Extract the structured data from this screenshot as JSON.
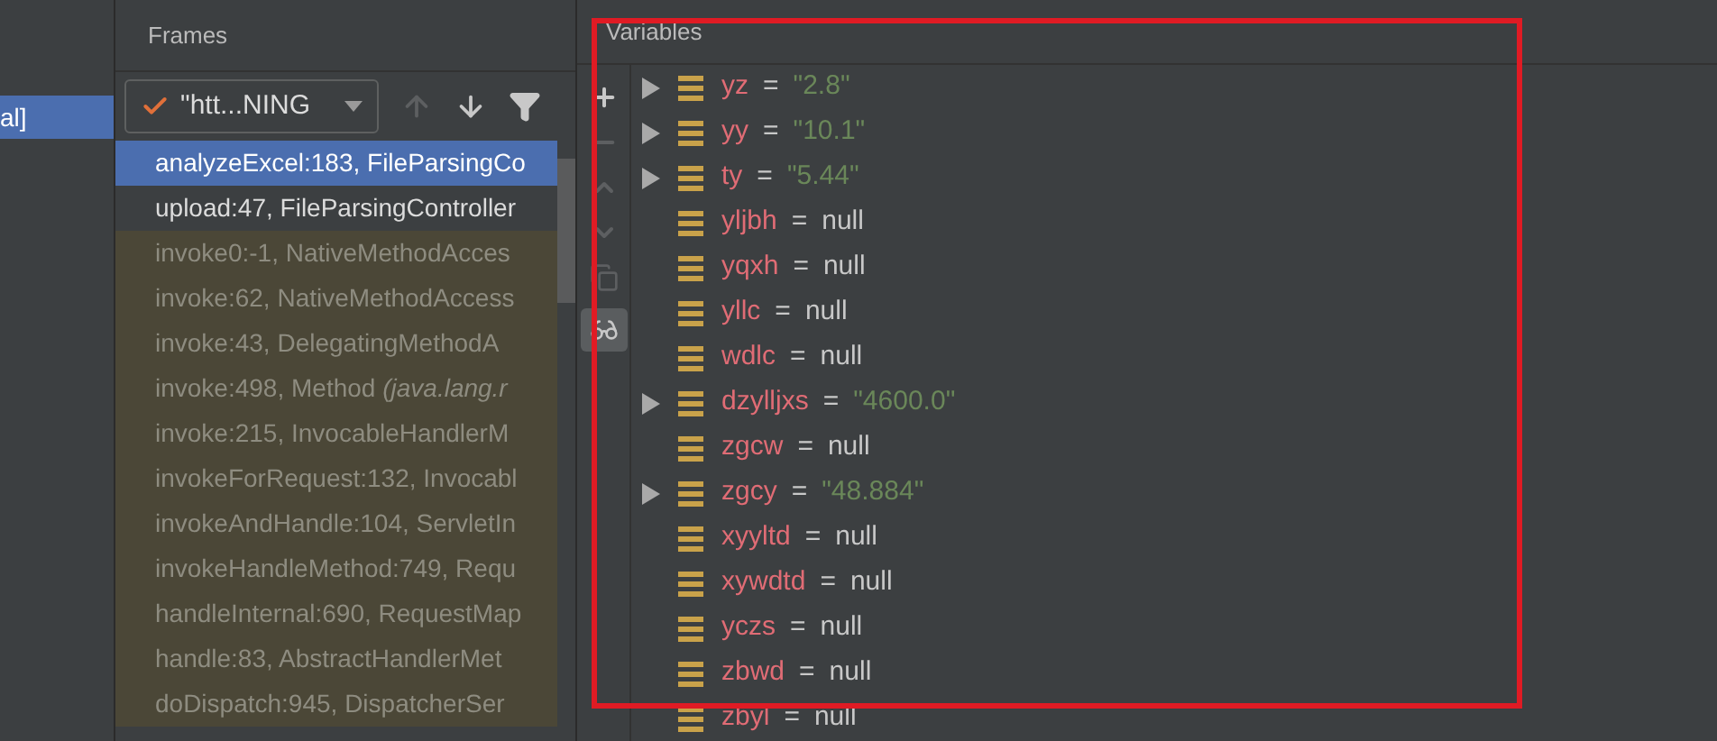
{
  "left_strip": {
    "item": {
      "label": "al]",
      "selected": true
    }
  },
  "frames": {
    "title": "Frames",
    "thread_dropdown": {
      "label": "\"htt...NING"
    },
    "items": [
      {
        "label": "analyzeExcel:183, FileParsingCo",
        "kind": "app",
        "selected": true
      },
      {
        "label": "upload:47, FileParsingController",
        "kind": "app",
        "selected": false
      },
      {
        "label": "invoke0:-1, NativeMethodAcces",
        "kind": "library",
        "selected": false
      },
      {
        "label": "invoke:62, NativeMethodAccess",
        "kind": "library",
        "selected": false
      },
      {
        "label": "invoke:43, DelegatingMethodA",
        "kind": "library",
        "selected": false
      },
      {
        "label": "invoke:498, Method *(java.lang.r*",
        "kind": "library",
        "selected": false
      },
      {
        "label": "invoke:215, InvocableHandlerM",
        "kind": "library",
        "selected": false
      },
      {
        "label": "invokeForRequest:132, Invocabl",
        "kind": "library",
        "selected": false
      },
      {
        "label": "invokeAndHandle:104, ServletIn",
        "kind": "library",
        "selected": false
      },
      {
        "label": "invokeHandleMethod:749, Requ",
        "kind": "library",
        "selected": false
      },
      {
        "label": "handleInternal:690, RequestMap",
        "kind": "library",
        "selected": false
      },
      {
        "label": "handle:83, AbstractHandlerMet",
        "kind": "library",
        "selected": false
      },
      {
        "label": "doDispatch:945, DispatcherSer",
        "kind": "library",
        "selected": false
      }
    ]
  },
  "variables": {
    "title": "Variables",
    "highlighted": true,
    "items": [
      {
        "name": "yz",
        "value": "\"2.8\"",
        "kind": "string",
        "expandable": true
      },
      {
        "name": "yy",
        "value": "\"10.1\"",
        "kind": "string",
        "expandable": true
      },
      {
        "name": "ty",
        "value": "\"5.44\"",
        "kind": "string",
        "expandable": true
      },
      {
        "name": "yljbh",
        "value": "null",
        "kind": "null",
        "expandable": false
      },
      {
        "name": "yqxh",
        "value": "null",
        "kind": "null",
        "expandable": false
      },
      {
        "name": "yllc",
        "value": "null",
        "kind": "null",
        "expandable": false
      },
      {
        "name": "wdlc",
        "value": "null",
        "kind": "null",
        "expandable": false
      },
      {
        "name": "dzylljxs",
        "value": "\"4600.0\"",
        "kind": "string",
        "expandable": true
      },
      {
        "name": "zgcw",
        "value": "null",
        "kind": "null",
        "expandable": false
      },
      {
        "name": "zgcy",
        "value": "\"48.884\"",
        "kind": "string",
        "expandable": true
      },
      {
        "name": "xyyltd",
        "value": "null",
        "kind": "null",
        "expandable": false
      },
      {
        "name": "xywdtd",
        "value": "null",
        "kind": "null",
        "expandable": false
      },
      {
        "name": "yczs",
        "value": "null",
        "kind": "null",
        "expandable": false
      },
      {
        "name": "zbwd",
        "value": "null",
        "kind": "null",
        "expandable": false
      },
      {
        "name": "zbyl",
        "value": "null",
        "kind": "null",
        "expandable": false
      }
    ],
    "eq": "="
  }
}
